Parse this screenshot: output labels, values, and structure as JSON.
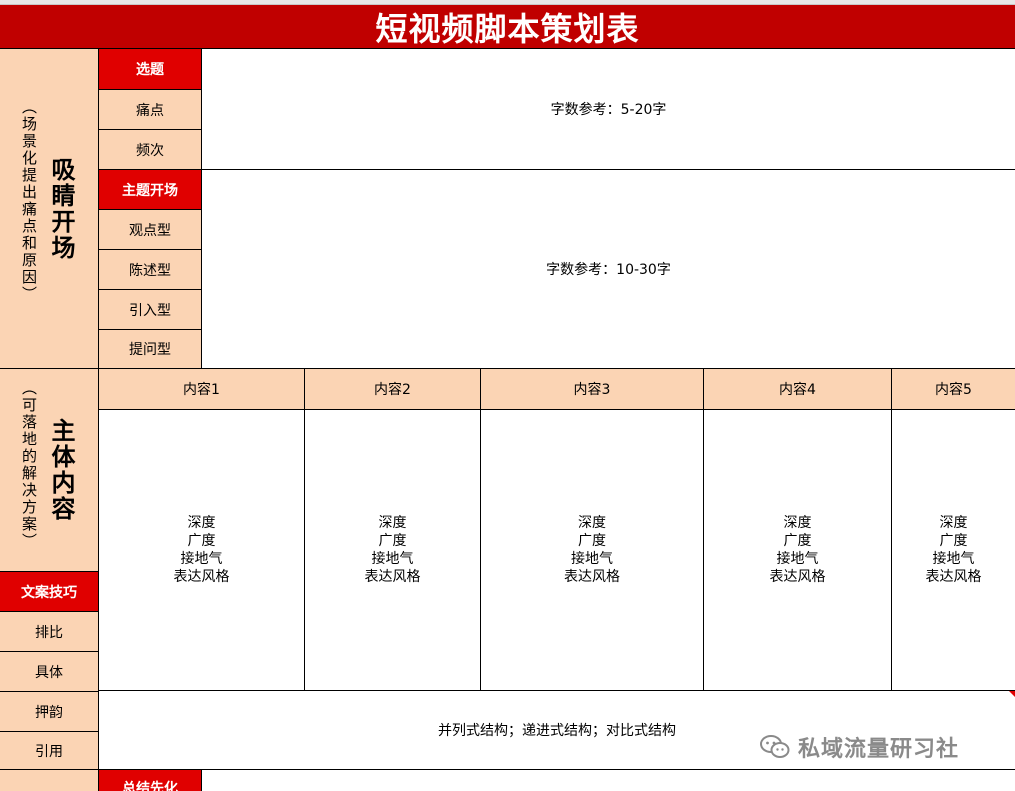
{
  "title": "短视频脚本策划表",
  "section_hook": {
    "title": "吸睛开场",
    "subtitle": "（场景化提出痛点和原因）"
  },
  "section_main": {
    "title": "主体内容",
    "subtitle": "（可落地的解决方案）"
  },
  "topic_rows": {
    "header": "选题",
    "items": [
      "痛点",
      "频次"
    ],
    "note": "字数参考：5-20字"
  },
  "opening_rows": {
    "header": "主题开场",
    "items": [
      "观点型",
      "陈述型",
      "引入型",
      "提问型"
    ],
    "note": "字数参考：10-30字"
  },
  "content_columns": {
    "headers": [
      "内容1",
      "内容2",
      "内容3",
      "内容4",
      "内容5"
    ],
    "body_lines": [
      "深度",
      "广度",
      "接地气",
      "表达风格"
    ]
  },
  "copy_skills": {
    "header": "文案技巧",
    "items": [
      "排比",
      "具体",
      "押韵",
      "引用"
    ],
    "note": "并列式结构；递进式结构；对比式结构"
  },
  "summary": {
    "header": "总结先化"
  },
  "watermark": {
    "text": "私域流量研习社",
    "icon": "wechat-icon"
  },
  "colors": {
    "title_red": "#c00000",
    "header_red": "#e00000",
    "peach": "#fbd4b4"
  }
}
